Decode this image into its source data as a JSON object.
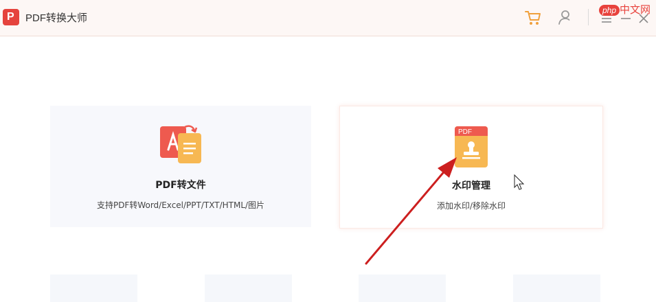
{
  "app": {
    "title": "PDF转换大师",
    "logo_letter": "P"
  },
  "watermark_site": {
    "badge": "php",
    "text": "中文网"
  },
  "cards": [
    {
      "title": "PDF转文件",
      "description": "支持PDF转Word/Excel/PPT/TXT/HTML/图片",
      "icon": "pdf-convert-icon"
    },
    {
      "title": "水印管理",
      "description": "添加水印/移除水印",
      "icon": "pdf-stamp-icon",
      "icon_label": "PDF"
    }
  ],
  "colors": {
    "accent": "#e5433d",
    "cart_icon": "#f0a03c",
    "annotation_arrow": "#cc1f1f"
  },
  "icons": [
    "cart-icon",
    "user-icon",
    "menu-icon",
    "minimize-icon",
    "close-icon"
  ]
}
